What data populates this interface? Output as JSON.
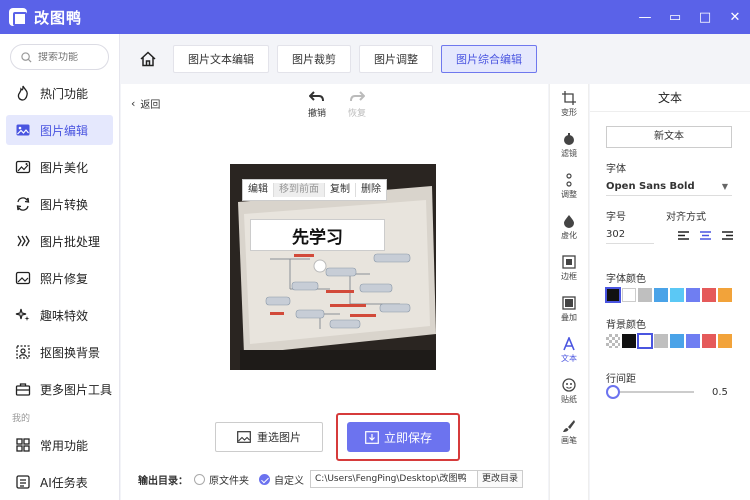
{
  "app": {
    "title": "改图鸭"
  },
  "window": {
    "min": "—",
    "restore": "▭",
    "max": "□",
    "close": "✕"
  },
  "search": {
    "placeholder": "搜索功能"
  },
  "sidebar": {
    "items": [
      {
        "label": "热门功能",
        "icon": "fire-icon"
      },
      {
        "label": "图片编辑",
        "icon": "image-edit-icon",
        "active": true
      },
      {
        "label": "图片美化",
        "icon": "image-beautify-icon"
      },
      {
        "label": "图片转换",
        "icon": "convert-icon"
      },
      {
        "label": "图片批处理",
        "icon": "batch-icon"
      },
      {
        "label": "照片修复",
        "icon": "repair-icon"
      },
      {
        "label": "趣味特效",
        "icon": "sparkle-icon"
      },
      {
        "label": "抠图换背景",
        "icon": "cutout-icon"
      },
      {
        "label": "更多图片工具",
        "icon": "toolbox-icon"
      }
    ],
    "section_mine": "我的",
    "mine_items": [
      {
        "label": "常用功能",
        "icon": "grid-icon"
      },
      {
        "label": "AI任务表",
        "icon": "ai-task-icon"
      }
    ]
  },
  "tabs": [
    "图片文本编辑",
    "图片裁剪",
    "图片调整",
    "图片综合编辑"
  ],
  "active_tab": 3,
  "workspace": {
    "back": "返回",
    "undo": "撤销",
    "redo": "恢复",
    "context_menu": [
      "编辑",
      "移到前面",
      "复制",
      "删除"
    ],
    "overlay_text": "先学习",
    "reselect": "重选图片",
    "save": "立即保存",
    "output_label": "输出目录：",
    "opt_original": "原文件夹",
    "opt_custom": "自定义",
    "path": "C:\\Users\\FengPing\\Desktop\\改图鸭",
    "change_dir": "更改目录"
  },
  "tools": [
    {
      "label": "变形",
      "icon": "transform-icon"
    },
    {
      "label": "滤镜",
      "icon": "filter-icon"
    },
    {
      "label": "调整",
      "icon": "adjust-icon"
    },
    {
      "label": "虚化",
      "icon": "blur-icon"
    },
    {
      "label": "边框",
      "icon": "border-icon"
    },
    {
      "label": "叠加",
      "icon": "overlay-icon"
    },
    {
      "label": "文本",
      "icon": "text-icon",
      "active": true
    },
    {
      "label": "贴纸",
      "icon": "sticker-icon"
    },
    {
      "label": "画笔",
      "icon": "brush-icon"
    }
  ],
  "panel": {
    "title": "文本",
    "new_text": "新文本",
    "font_label": "字体",
    "font_value": "Open Sans Bold",
    "size_label": "字号",
    "size_value": "302",
    "align_label": "对齐方式",
    "font_color_label": "字体颜色",
    "bg_color_label": "背景颜色",
    "line_spacing_label": "行间距",
    "line_spacing_value": "0.5",
    "font_colors": [
      "#111111",
      "#ffffff",
      "#bfbfbf",
      "#4aa3e8",
      "#5bc8f5",
      "#6f7ef2",
      "#e55a5a",
      "#f2a33a"
    ],
    "bg_colors": [
      "#cfcfcf",
      "#111111",
      "#ffffff",
      "#bfbfbf",
      "#4aa3e8",
      "#6f7ef2",
      "#e55a5a",
      "#f2a33a"
    ],
    "accent": "#6c73ef"
  }
}
